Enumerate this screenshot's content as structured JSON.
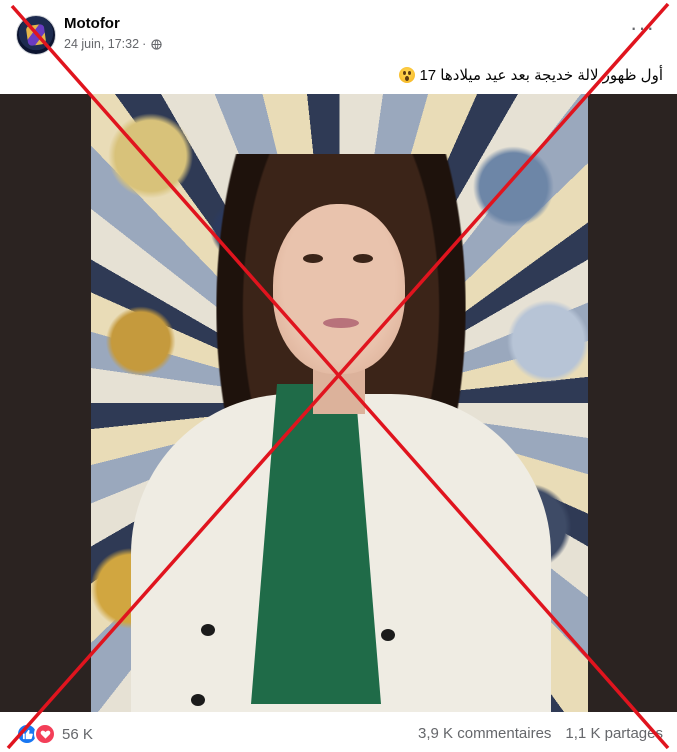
{
  "post": {
    "author": "Motofor",
    "timestamp": "24 juin, 17:32",
    "separator": "·",
    "audience_icon": "globe-icon",
    "more_glyph": "···",
    "caption": "أول ظهور لالة خديجة بعد عيد ميلادها 17",
    "caption_emoji": "astonished-face-emoji"
  },
  "footer": {
    "reactions": [
      "like-icon",
      "love-icon"
    ],
    "reaction_count": "56 K",
    "comments": "3,9 K commentaires",
    "shares": "1,1 K partages"
  },
  "overlay": {
    "type": "red-cross",
    "color": "#e0141e"
  },
  "colors": {
    "text_primary": "#050505",
    "text_secondary": "#65676b",
    "like_blue": "#1877f2",
    "love_red": "#f33e58",
    "media_bg": "#2b2321"
  }
}
